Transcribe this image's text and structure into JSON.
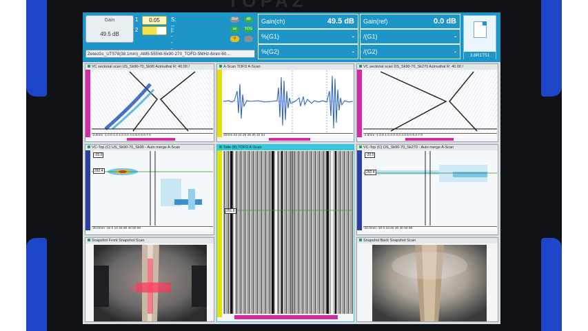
{
  "device": {
    "brand": "TOPAZ"
  },
  "topbar": {
    "gain_box": {
      "title": "Gain",
      "value": "49.5 dB"
    },
    "cursors": [
      {
        "index": "1",
        "value": "0.05",
        "label": "S: ---"
      },
      {
        "index": "2",
        "value": "",
        "label": "I: ---"
      }
    ],
    "probe_info": "ZetecGc_UT578(38.1mm)_AM5-555W-Sk90-270_TOFD-5MHz-6mm-60…",
    "chips": [
      {
        "label": "Ref",
        "color": "#8a8f94"
      },
      {
        "label": "dB",
        "color": "#2fae4a"
      },
      {
        "label": "us",
        "color": "#2fae4a"
      },
      {
        "label": "TCG",
        "color": "#2fae4a"
      },
      {
        "label": "V",
        "color": "#e3c21a"
      },
      {
        "label": "",
        "color": "#8a8f94"
      }
    ],
    "gain_ch": {
      "label": "Gain(ch)",
      "value": "49.5 dB"
    },
    "g1": {
      "label": "%(G1)",
      "value": "-"
    },
    "g2": {
      "label": "%(G2)",
      "value": "-"
    },
    "gain_ref": {
      "label": "Gain(ref)",
      "value": "0.0 dB"
    },
    "ref_g1": {
      "label": "/(G1)",
      "value": "-"
    },
    "ref_g2": {
      "label": "/(G2)",
      "value": "-"
    },
    "version": "3.8R1T51"
  },
  "panels": {
    "vc_sector_left": {
      "title": "VC sectorial scan US_Sk90-70_Sk90 Azimuthal  R: 40.00 /",
      "ruler": "-2.0mm  -1.0  0  1.0  2.0  3.0  4.0  5.0  6.0  7.0"
    },
    "ascan_tofd": {
      "title": "A-Scan TOFD A-Scan",
      "ruler": "20mm 22  24  26  28  30  32  34"
    },
    "vc_sector_right": {
      "title": "VC sectorial scan DS_Sk90-70_Sk270 Azimuthal  R: 40.00 /",
      "ruler": "-2.0mm -1.0  0  1.0  2.0  3.0  4.0  5.0  6.0  7.0"
    },
    "vc_top_left": {
      "title": "VC-Top (C) US_Sk90-70_Sk90 - Auto merge A-Scan",
      "label_a": "-20.0",
      "label_b": "292.4",
      "ruler": "-20.0mm  -10  0  10  20  30  40  50  60"
    },
    "side_tofd": {
      "title": "Side (B) TOFD A-Scan",
      "cursor_value": "291.9"
    },
    "vc_top_right": {
      "title": "VC-Top (C) DS_Sk90-70_Sk270 - Auto merge A-Scan",
      "label_a": "-20.0",
      "label_b": "292.4",
      "ruler": "-20.0mm  -10  0  10  20  30  40  50  60"
    },
    "snapshot_front": {
      "title": "Snapshot Front Snapshot Scan"
    },
    "snapshot_back": {
      "title": "Snapshot Back Snapshot Scan"
    }
  },
  "colors": {
    "accent": "#1d95c9",
    "bumper": "#1d46c8",
    "magenta": "#d42aa3",
    "yellow": "#e6e000",
    "signal": "#2f63c7"
  }
}
